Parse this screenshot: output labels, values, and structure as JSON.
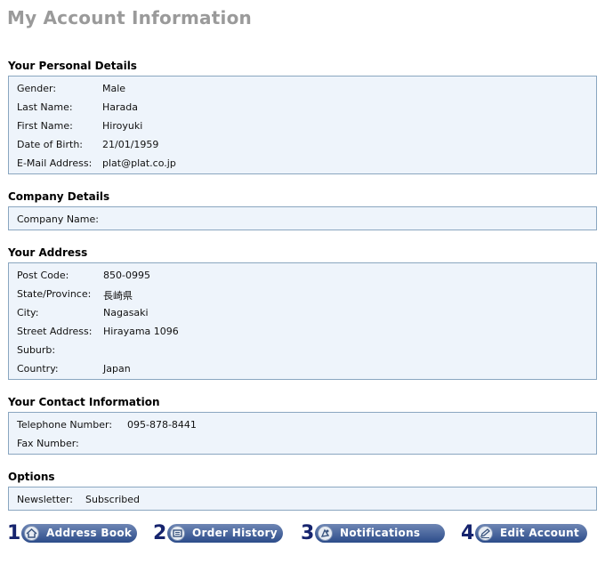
{
  "page_title": "My Account Information",
  "personal": {
    "heading": "Your Personal Details",
    "rows": [
      {
        "label": "Gender:",
        "value": "Male"
      },
      {
        "label": "Last Name:",
        "value": "Harada"
      },
      {
        "label": "First Name:",
        "value": "Hiroyuki"
      },
      {
        "label": "Date of Birth:",
        "value": "21/01/1959"
      },
      {
        "label": "E-Mail Address:",
        "value": "plat@plat.co.jp"
      }
    ]
  },
  "company": {
    "heading": "Company Details",
    "rows": [
      {
        "label": "Company Name:",
        "value": ""
      }
    ]
  },
  "address": {
    "heading": "Your Address",
    "rows": [
      {
        "label": "Post Code:",
        "value": "850-0995"
      },
      {
        "label": "State/Province:",
        "value": "長崎県"
      },
      {
        "label": "City:",
        "value": "Nagasaki"
      },
      {
        "label": "Street Address:",
        "value": "Hirayama 1096"
      },
      {
        "label": "Suburb:",
        "value": ""
      },
      {
        "label": "Country:",
        "value": "Japan"
      }
    ]
  },
  "contact": {
    "heading": "Your Contact Information",
    "rows": [
      {
        "label": "Telephone Number:",
        "value": "095-878-8441"
      },
      {
        "label": "Fax Number:",
        "value": ""
      }
    ]
  },
  "options": {
    "heading": "Options",
    "rows": [
      {
        "label": "Newsletter:",
        "value": "Subscribed"
      }
    ]
  },
  "nav": [
    {
      "number": "1",
      "label": "Address Book",
      "icon": "house-icon"
    },
    {
      "number": "2",
      "label": "Order History",
      "icon": "history-icon"
    },
    {
      "number": "3",
      "label": "Notifications",
      "icon": "notification-icon"
    },
    {
      "number": "4",
      "label": "Edit Account",
      "icon": "edit-icon"
    }
  ]
}
